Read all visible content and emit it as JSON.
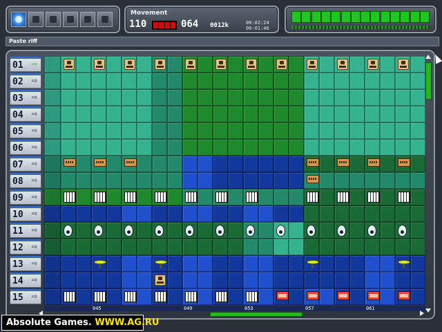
{
  "window": {
    "status_text": "Paste riff"
  },
  "toolbar": {
    "buttons": [
      {
        "name": "globe-icon"
      },
      {
        "name": "monitor-icon"
      },
      {
        "name": "network-icon"
      },
      {
        "name": "save-disk-icon"
      },
      {
        "name": "gear-icon"
      },
      {
        "name": "grid-icon"
      }
    ],
    "active_index": 0
  },
  "movement": {
    "title": "Movement",
    "tempo": "110",
    "bar": "064",
    "size": "0012k",
    "time_elapsed": "00:02:24",
    "time_total": "00:01:46"
  },
  "level_meter": {
    "segments": 14,
    "lit": 14,
    "color": "#1ec61e"
  },
  "colors": {
    "light_teal": "#35b38e",
    "dark_teal": "#228a68",
    "green": "#1f8a2c",
    "dark_green": "#1a6a36",
    "blue": "#13389c",
    "bright_blue": "#2050cc"
  },
  "tracks": [
    {
      "number": "01",
      "active": true
    },
    {
      "number": "02",
      "active": false
    },
    {
      "number": "03",
      "active": false
    },
    {
      "number": "04",
      "active": false
    },
    {
      "number": "05",
      "active": false
    },
    {
      "number": "06",
      "active": false
    },
    {
      "number": "07",
      "active": false
    },
    {
      "number": "08",
      "active": false
    },
    {
      "number": "09",
      "active": false
    },
    {
      "number": "10",
      "active": false
    },
    {
      "number": "11",
      "active": false
    },
    {
      "number": "12",
      "active": false
    },
    {
      "number": "13",
      "active": false
    },
    {
      "number": "14",
      "active": false
    },
    {
      "number": "15",
      "active": false
    }
  ],
  "timeline_labels": [
    {
      "label": "045",
      "column": 1
    },
    {
      "label": "049",
      "column": 4
    },
    {
      "label": "053",
      "column": 6
    },
    {
      "label": "057",
      "column": 8
    },
    {
      "label": "061",
      "column": 10
    }
  ],
  "sequencer": {
    "columns": 12,
    "row_colors": [
      [
        "lt",
        "lt",
        "lt",
        "dt",
        "g",
        "g",
        "g",
        "g",
        "lt",
        "lt",
        "lt",
        "lt"
      ],
      [
        "lt",
        "lt",
        "lt",
        "dt",
        "g",
        "g",
        "g",
        "g",
        "lt",
        "lt",
        "lt",
        "lt"
      ],
      [
        "lt",
        "lt",
        "lt",
        "dt",
        "g",
        "g",
        "g",
        "g",
        "lt",
        "lt",
        "lt",
        "lt"
      ],
      [
        "lt",
        "lt",
        "lt",
        "dt",
        "g",
        "g",
        "g",
        "g",
        "lt",
        "lt",
        "lt",
        "lt"
      ],
      [
        "lt",
        "lt",
        "lt",
        "dt",
        "g",
        "g",
        "g",
        "g",
        "lt",
        "lt",
        "lt",
        "lt"
      ],
      [
        "lt",
        "lt",
        "lt",
        "dt",
        "g",
        "g",
        "g",
        "g",
        "lt",
        "lt",
        "lt",
        "lt"
      ],
      [
        "dt",
        "dt",
        "dt",
        "dt",
        "bb",
        "b",
        "b",
        "b",
        "dg",
        "dg",
        "dg",
        "dg"
      ],
      [
        "dt",
        "dt",
        "dt",
        "dt",
        "bb",
        "b",
        "b",
        "b",
        "dt",
        "dt",
        "dt",
        "dt"
      ],
      [
        "g",
        "g",
        "g",
        "g",
        "dt",
        "dt",
        "dt",
        "dt",
        "dg",
        "dg",
        "dg",
        "dg"
      ],
      [
        "b",
        "b",
        "bb",
        "b",
        "bb",
        "b",
        "bb",
        "b",
        "dg",
        "dg",
        "dg",
        "dg"
      ],
      [
        "dg",
        "dg",
        "dg",
        "dg",
        "dg",
        "dg",
        "dt",
        "lt",
        "dg",
        "dg",
        "dg",
        "dg"
      ],
      [
        "dg",
        "dg",
        "dg",
        "dg",
        "dg",
        "dg",
        "dt",
        "lt",
        "dg",
        "dg",
        "dg",
        "dg"
      ],
      [
        "b",
        "b",
        "bb",
        "b",
        "bb",
        "b",
        "bb",
        "b",
        "b",
        "b",
        "bb",
        "b"
      ],
      [
        "b",
        "b",
        "bb",
        "b",
        "bb",
        "b",
        "bb",
        "b",
        "b",
        "b",
        "bb",
        "b"
      ],
      [
        "b",
        "b",
        "bb",
        "b",
        "bb",
        "b",
        "bb",
        "b",
        "bb",
        "b",
        "bb",
        "b"
      ]
    ],
    "notes": [
      {
        "row": 0,
        "cols": [
          0,
          1,
          2,
          3,
          4,
          5,
          6,
          7,
          8,
          9,
          10,
          11
        ],
        "icon": "cpu-icon"
      },
      {
        "row": 6,
        "cols": [
          0,
          1,
          2,
          8,
          9,
          10,
          11
        ],
        "icon": "amp-icon"
      },
      {
        "row": 7,
        "cols": [
          8
        ],
        "icon": "amp-icon"
      },
      {
        "row": 8,
        "cols": [
          0,
          1,
          2,
          3,
          4,
          5,
          6,
          8,
          9,
          10,
          11
        ],
        "icon": "keyboard-icon"
      },
      {
        "row": 10,
        "cols": [
          0,
          1,
          2,
          3,
          4,
          5,
          6,
          7,
          8,
          9,
          10,
          11
        ],
        "icon": "eye-icon"
      },
      {
        "row": 12,
        "cols": [
          1,
          3,
          8,
          11
        ],
        "icon": "cymbal-icon"
      },
      {
        "row": 13,
        "cols": [
          3
        ],
        "icon": "cpu-icon"
      },
      {
        "row": 14,
        "cols": [
          0,
          1,
          2,
          3,
          4,
          5,
          6
        ],
        "icon": "keyboard-icon"
      },
      {
        "row": 14,
        "cols": [
          7,
          8,
          9,
          10,
          11
        ],
        "icon": "drum-icon"
      }
    ]
  },
  "watermark": {
    "text": "Absolute Games.",
    "url": "WWW.AG.RU"
  }
}
